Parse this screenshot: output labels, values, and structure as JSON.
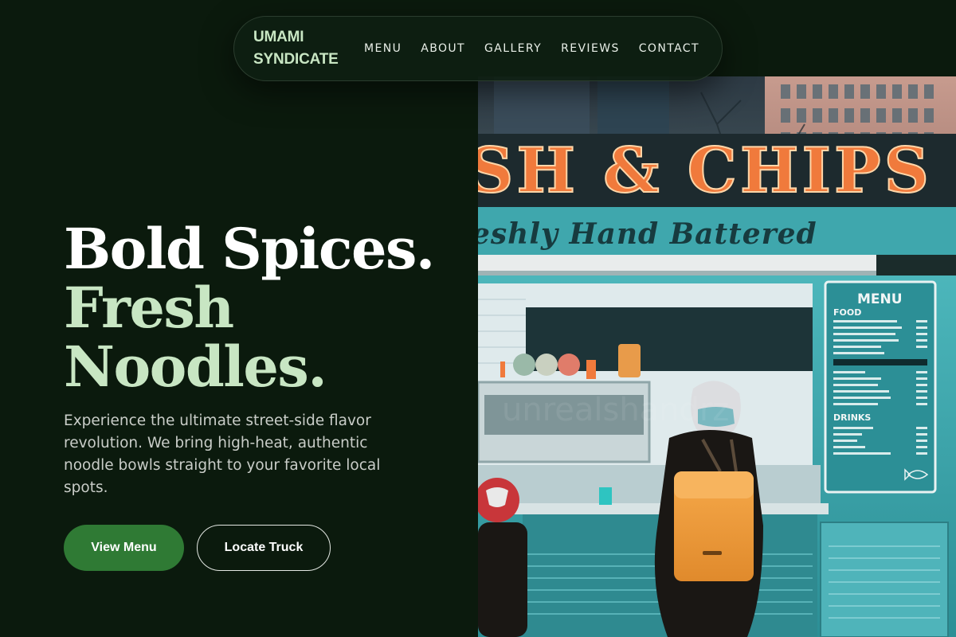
{
  "nav": {
    "logo_line1": "UMAMI",
    "logo_line2": "SYNDICATE",
    "links": [
      "MENU",
      "ABOUT",
      "GALLERY",
      "REVIEWS",
      "CONTACT"
    ]
  },
  "hero": {
    "title_line1": "Bold Spices.",
    "title_line2": "Fresh",
    "title_line3": "Noodles.",
    "description": "Experience the ultimate street-side flavor revolution. We bring high-heat, authentic noodle bowls straight to your favorite local spots.",
    "primary_button": "View Menu",
    "secondary_button": "Locate Truck"
  },
  "photo": {
    "sign": "SH & CHIPS",
    "banner": "eshly Hand Battered",
    "menu_board": {
      "title": "MENU",
      "section1": "FOOD",
      "section2": "DRINKS"
    }
  },
  "colors": {
    "background": "#0b1a0d",
    "accent_green": "#2f7a34",
    "mint": "#c8e6c3",
    "truck_teal": "#3fa7ad",
    "sign_orange": "#f07a3c"
  }
}
